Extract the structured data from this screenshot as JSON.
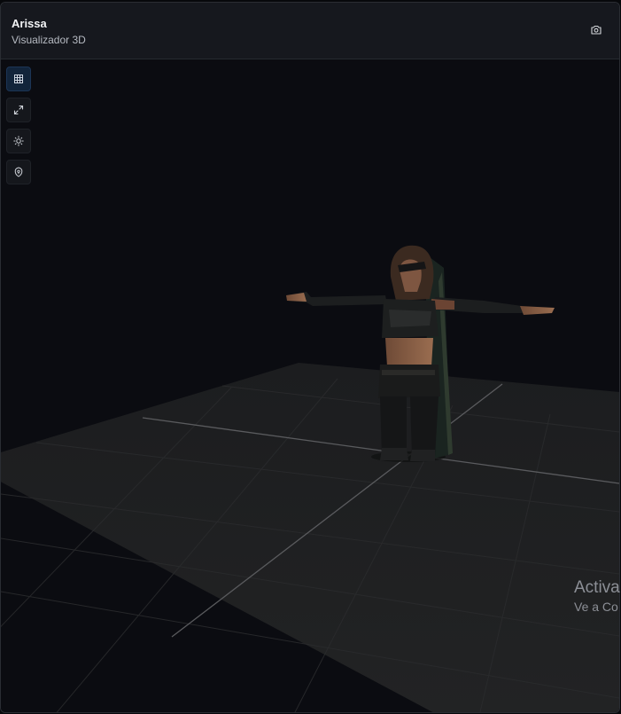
{
  "header": {
    "title": "Arissa",
    "subtitle": "Visualizador 3D",
    "screenshot_icon": "camera-icon"
  },
  "toolbar": {
    "items": [
      {
        "icon": "grid-icon",
        "active": true
      },
      {
        "icon": "expand-icon",
        "active": false
      },
      {
        "icon": "sun-icon",
        "active": false
      },
      {
        "icon": "shield-icon",
        "active": false
      }
    ]
  },
  "viewport": {
    "model_name": "Arissa",
    "background": "#0b0c11",
    "floor_color": "#1e1f21"
  },
  "watermark": {
    "line1": "Activa",
    "line2": "Ve a Co"
  }
}
